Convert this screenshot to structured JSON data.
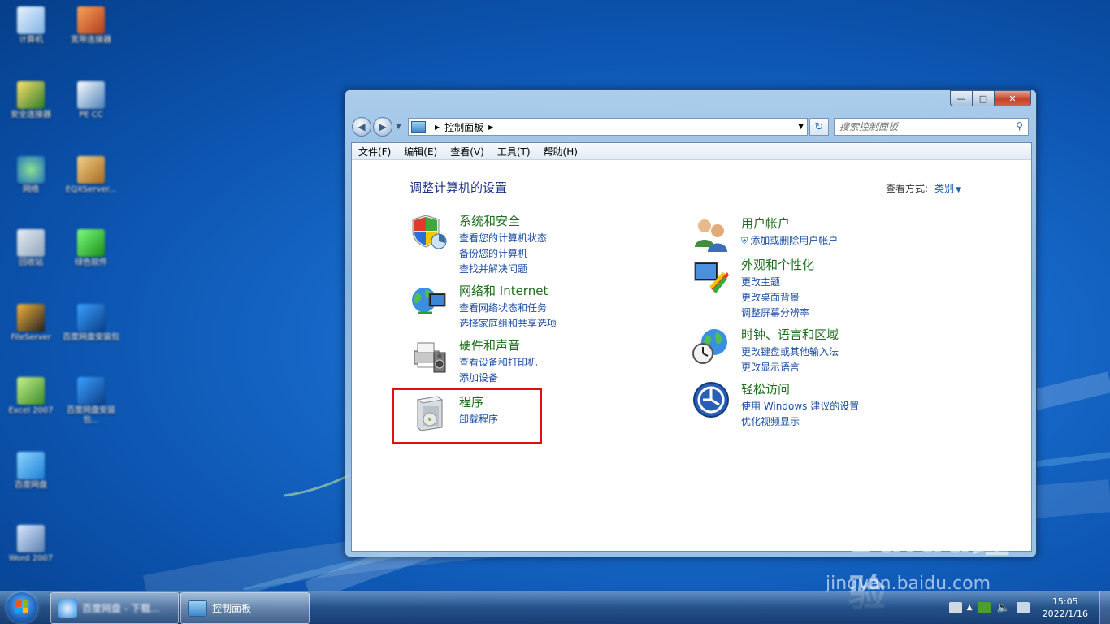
{
  "desktop": {
    "icons": [
      {
        "label": "计算机"
      },
      {
        "label": "宽带连接器"
      },
      {
        "label": "安全连接器"
      },
      {
        "label": "PE CC"
      },
      {
        "label": "网络"
      },
      {
        "label": "EQXServer..."
      },
      {
        "label": "回收站"
      },
      {
        "label": "绿色软件"
      },
      {
        "label": "FileServer"
      },
      {
        "label": "百度网盘安装包"
      },
      {
        "label": "Excel 2007"
      },
      {
        "label": "百度网盘安装包..."
      },
      {
        "label": "百度网盘"
      },
      {
        "label": "Word 2007"
      }
    ]
  },
  "window": {
    "address": {
      "root_label": "控制面板"
    },
    "search": {
      "placeholder": "搜索控制面板"
    },
    "menu": [
      "文件(F)",
      "编辑(E)",
      "查看(V)",
      "工具(T)",
      "帮助(H)"
    ],
    "heading": "调整计算机的设置",
    "view_by": {
      "label": "查看方式:",
      "value": "类别"
    },
    "left_categories": [
      {
        "title": "系统和安全",
        "links": [
          "查看您的计算机状态",
          "备份您的计算机",
          "查找并解决问题"
        ]
      },
      {
        "title": "网络和 Internet",
        "links": [
          "查看网络状态和任务",
          "选择家庭组和共享选项"
        ]
      },
      {
        "title": "硬件和声音",
        "links": [
          "查看设备和打印机",
          "添加设备"
        ]
      },
      {
        "title": "程序",
        "links": [
          "卸载程序"
        ]
      }
    ],
    "right_categories": [
      {
        "title": "用户帐户",
        "links": [
          "添加或删除用户帐户"
        ]
      },
      {
        "title": "外观和个性化",
        "links": [
          "更改主题",
          "更改桌面背景",
          "调整屏幕分辨率"
        ]
      },
      {
        "title": "时钟、语言和区域",
        "links": [
          "更改键盘或其他输入法",
          "更改显示语言"
        ]
      },
      {
        "title": "轻松访问",
        "links": [
          "使用 Windows 建议的设置",
          "优化视频显示"
        ]
      }
    ]
  },
  "taskbar": {
    "items": [
      {
        "label": "百度网盘 - 下载..."
      },
      {
        "label": "控制面板"
      }
    ],
    "clock": {
      "time": "15:05",
      "date": "2022/1/16"
    }
  },
  "watermark": {
    "logo": "Baidu经验",
    "url": "jingyan.baidu.com"
  }
}
